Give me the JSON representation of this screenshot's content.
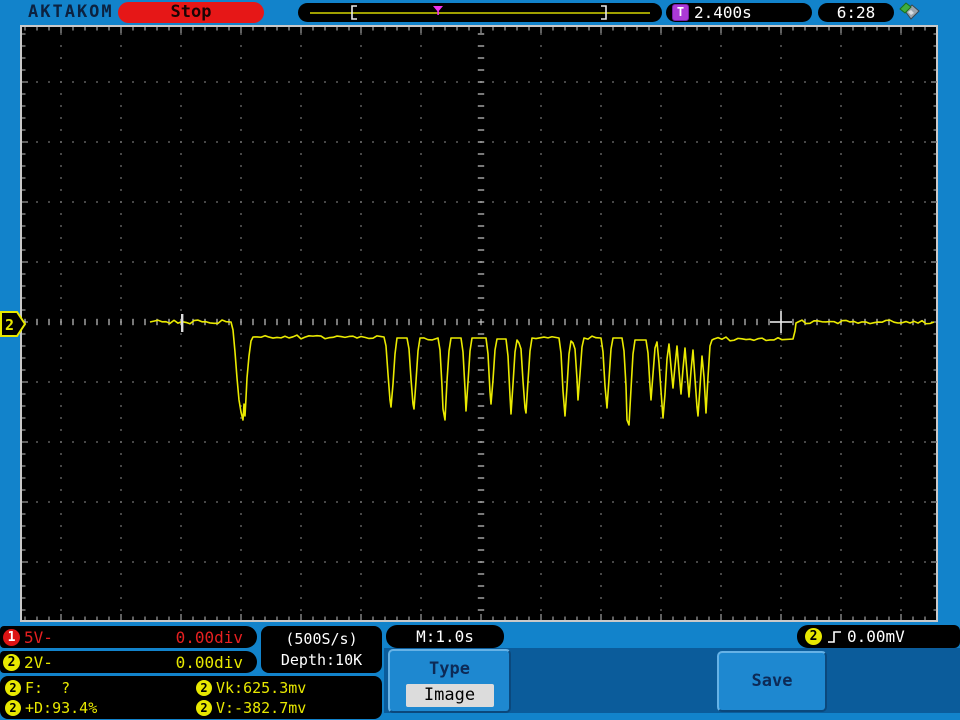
{
  "colors": {
    "bg_blue": "#1283cb",
    "panel_blue": "#0b5c9b",
    "button_blue": "#1e88d0",
    "trace_yellow": "#eaea00",
    "ch1_red": "#e62020",
    "ch2_yellow": "#e8e800",
    "stop_red": "#e61717",
    "trigger_purple": "#ab3ad6",
    "marker_magenta": "#ee33ee"
  },
  "top_bar": {
    "brand": "AKTAKOM",
    "run_state": "Stop",
    "trigger_icon": "T",
    "trigger_time": "2.400s",
    "clock": "6:28"
  },
  "waveform": {
    "channel_badge": "2",
    "trigger_cross": [
      781,
      322
    ],
    "time_marker": [
      182,
      323
    ],
    "points": [
      [
        150,
        322
      ],
      [
        231,
        322
      ],
      [
        233,
        330
      ],
      [
        235,
        352
      ],
      [
        237,
        378
      ],
      [
        239,
        400
      ],
      [
        241,
        412
      ],
      [
        243,
        420
      ],
      [
        244,
        404
      ],
      [
        245,
        416
      ],
      [
        246,
        398
      ],
      [
        247,
        378
      ],
      [
        249,
        356
      ],
      [
        251,
        341
      ],
      [
        253,
        337
      ],
      [
        384,
        337
      ],
      [
        386,
        346
      ],
      [
        388,
        374
      ],
      [
        390,
        400
      ],
      [
        391,
        407
      ],
      [
        393,
        384
      ],
      [
        395,
        354
      ],
      [
        397,
        338
      ],
      [
        407,
        338
      ],
      [
        409,
        349
      ],
      [
        411,
        379
      ],
      [
        413,
        404
      ],
      [
        414,
        409
      ],
      [
        416,
        381
      ],
      [
        418,
        351
      ],
      [
        420,
        338
      ],
      [
        438,
        338
      ],
      [
        440,
        350
      ],
      [
        442,
        386
      ],
      [
        443,
        409
      ],
      [
        445,
        420
      ],
      [
        447,
        381
      ],
      [
        449,
        351
      ],
      [
        451,
        338
      ],
      [
        461,
        338
      ],
      [
        463,
        352
      ],
      [
        465,
        389
      ],
      [
        466,
        411
      ],
      [
        468,
        382
      ],
      [
        470,
        351
      ],
      [
        472,
        338
      ],
      [
        486,
        338
      ],
      [
        488,
        354
      ],
      [
        490,
        392
      ],
      [
        491,
        404
      ],
      [
        493,
        380
      ],
      [
        495,
        350
      ],
      [
        497,
        339
      ],
      [
        506,
        339
      ],
      [
        508,
        356
      ],
      [
        510,
        396
      ],
      [
        511,
        414
      ],
      [
        513,
        384
      ],
      [
        515,
        352
      ],
      [
        517,
        340
      ],
      [
        519,
        343
      ],
      [
        521,
        349
      ],
      [
        523,
        381
      ],
      [
        525,
        408
      ],
      [
        526,
        413
      ],
      [
        528,
        381
      ],
      [
        530,
        351
      ],
      [
        532,
        338
      ],
      [
        559,
        338
      ],
      [
        561,
        353
      ],
      [
        563,
        391
      ],
      [
        565,
        416
      ],
      [
        567,
        387
      ],
      [
        569,
        354
      ],
      [
        571,
        341
      ],
      [
        573,
        343
      ],
      [
        575,
        349
      ],
      [
        577,
        379
      ],
      [
        578,
        400
      ],
      [
        580,
        374
      ],
      [
        582,
        347
      ],
      [
        584,
        338
      ],
      [
        601,
        338
      ],
      [
        603,
        352
      ],
      [
        605,
        386
      ],
      [
        607,
        408
      ],
      [
        609,
        379
      ],
      [
        611,
        349
      ],
      [
        613,
        338
      ],
      [
        622,
        338
      ],
      [
        624,
        351
      ],
      [
        626,
        386
      ],
      [
        627,
        420
      ],
      [
        629,
        425
      ],
      [
        631,
        389
      ],
      [
        633,
        354
      ],
      [
        635,
        340
      ],
      [
        646,
        340
      ],
      [
        648,
        353
      ],
      [
        650,
        386
      ],
      [
        651,
        400
      ],
      [
        653,
        374
      ],
      [
        655,
        348
      ],
      [
        657,
        342
      ],
      [
        659,
        363
      ],
      [
        661,
        391
      ],
      [
        663,
        418
      ],
      [
        665,
        394
      ],
      [
        667,
        359
      ],
      [
        669,
        344
      ],
      [
        671,
        367
      ],
      [
        673,
        388
      ],
      [
        675,
        366
      ],
      [
        677,
        346
      ],
      [
        679,
        371
      ],
      [
        681,
        394
      ],
      [
        683,
        369
      ],
      [
        685,
        348
      ],
      [
        687,
        373
      ],
      [
        689,
        397
      ],
      [
        691,
        371
      ],
      [
        693,
        350
      ],
      [
        695,
        379
      ],
      [
        697,
        407
      ],
      [
        698,
        416
      ],
      [
        700,
        387
      ],
      [
        702,
        356
      ],
      [
        704,
        377
      ],
      [
        706,
        413
      ],
      [
        708,
        377
      ],
      [
        710,
        346
      ],
      [
        712,
        340
      ],
      [
        714,
        339
      ],
      [
        793,
        339
      ],
      [
        795,
        331
      ],
      [
        796,
        323
      ],
      [
        798,
        322
      ],
      [
        934,
        322
      ]
    ]
  },
  "bottom": {
    "ch1": {
      "badge": "1",
      "scale": "5V-",
      "offset": "0.00div"
    },
    "ch2": {
      "badge": "2",
      "scale": "2V-",
      "offset": "0.00div"
    },
    "sample_rate": "(500S/s)",
    "depth": "Depth:10K",
    "timebase": "M:1.0s",
    "trigger": {
      "badge": "2",
      "level": "0.00mV"
    },
    "measurements": [
      {
        "badge": "2",
        "text": "F:  ?"
      },
      {
        "badge": "2",
        "text": "Vk:625.3mv"
      },
      {
        "badge": "2",
        "text": "+D:93.4%"
      },
      {
        "badge": "2",
        "text": "V:-382.7mv"
      }
    ],
    "menu": {
      "title": "Type",
      "value": "Image"
    },
    "save_label": "Save"
  }
}
